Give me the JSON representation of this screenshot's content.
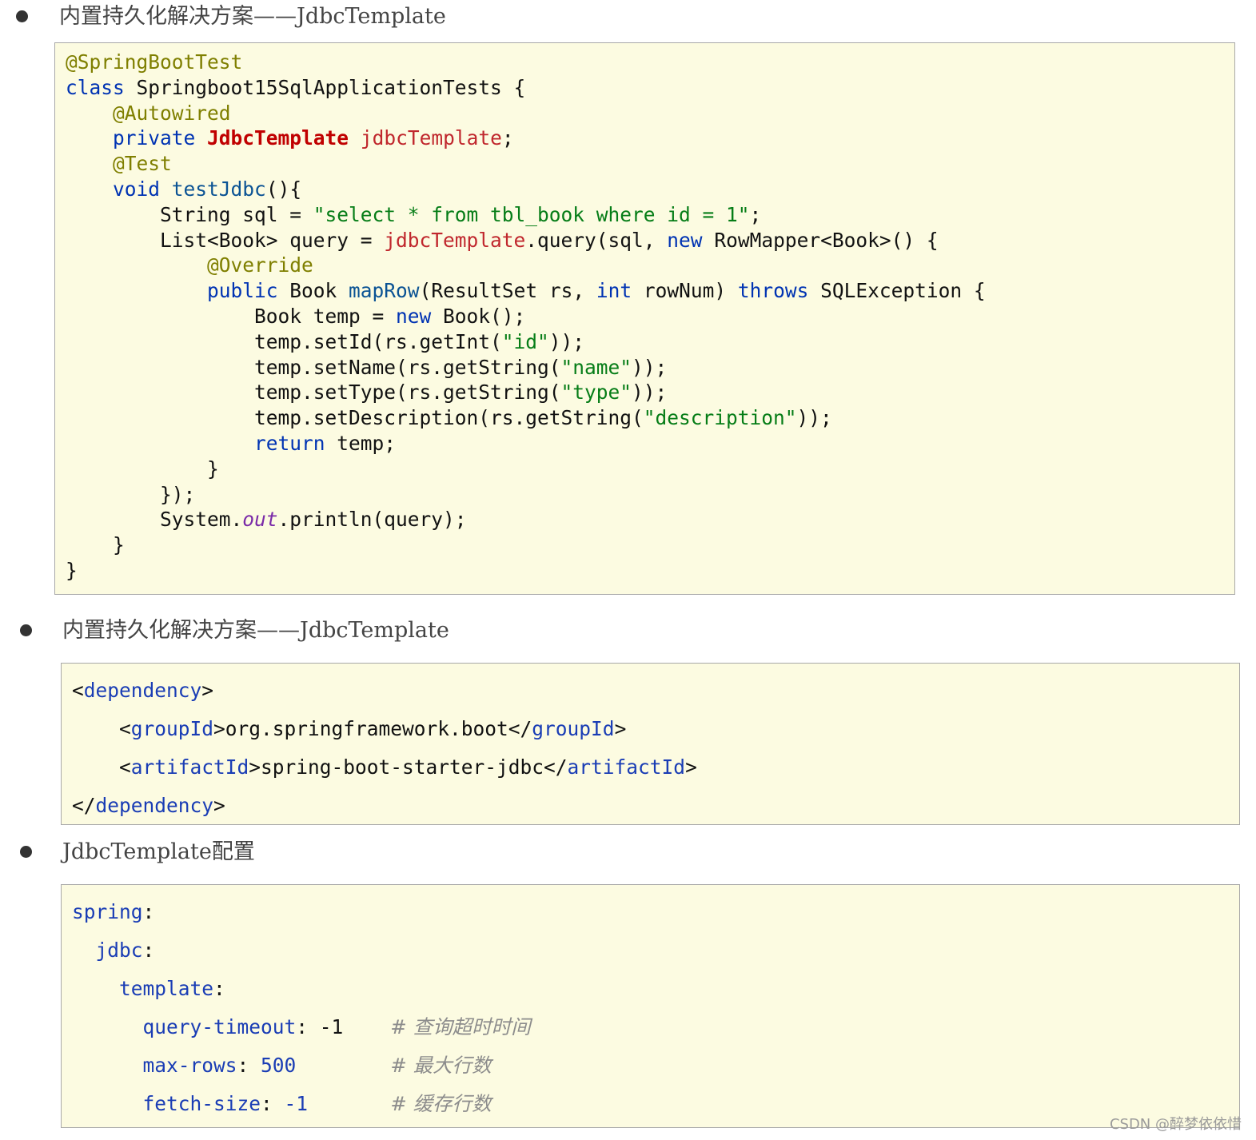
{
  "sections": [
    {
      "heading": "内置持久化解决方案——JdbcTemplate"
    },
    {
      "heading": "内置持久化解决方案——JdbcTemplate"
    },
    {
      "heading": "JdbcTemplate配置"
    }
  ],
  "code_java": [
    [
      [
        "@SpringBootTest",
        "ann"
      ]
    ],
    [
      [
        "class",
        "kw"
      ],
      [
        " Springboot15SqlApplicationTests {",
        ""
      ]
    ],
    [
      [
        "    ",
        ""
      ],
      [
        "@Autowired",
        "ann"
      ]
    ],
    [
      [
        "    ",
        ""
      ],
      [
        "private",
        "kw"
      ],
      [
        " ",
        ""
      ],
      [
        "JdbcTemplate",
        "cls"
      ],
      [
        " ",
        ""
      ],
      [
        "jdbcTemplate",
        "fld"
      ],
      [
        ";",
        ""
      ]
    ],
    [
      [
        "    ",
        ""
      ],
      [
        "@Test",
        "ann"
      ]
    ],
    [
      [
        "    ",
        ""
      ],
      [
        "void",
        "kw"
      ],
      [
        " ",
        ""
      ],
      [
        "testJdbc",
        "mth"
      ],
      [
        "(){",
        ""
      ]
    ],
    [
      [
        "        String sql = ",
        ""
      ],
      [
        "\"select * from tbl_book where id = 1\"",
        "str"
      ],
      [
        ";",
        ""
      ]
    ],
    [
      [
        "        List<Book> query = ",
        ""
      ],
      [
        "jdbcTemplate",
        "fld"
      ],
      [
        ".query(sql, ",
        ""
      ],
      [
        "new",
        "kw"
      ],
      [
        " RowMapper<Book>() {",
        ""
      ]
    ],
    [
      [
        "            ",
        ""
      ],
      [
        "@Override",
        "ann"
      ]
    ],
    [
      [
        "            ",
        ""
      ],
      [
        "public",
        "kw"
      ],
      [
        " Book ",
        ""
      ],
      [
        "mapRow",
        "mth"
      ],
      [
        "(ResultSet rs, ",
        ""
      ],
      [
        "int",
        "kw"
      ],
      [
        " rowNum) ",
        ""
      ],
      [
        "throws",
        "kw"
      ],
      [
        " SQLException {",
        ""
      ]
    ],
    [
      [
        "                Book temp = ",
        ""
      ],
      [
        "new",
        "kw"
      ],
      [
        " Book();",
        ""
      ]
    ],
    [
      [
        "                temp.setId(rs.getInt(",
        ""
      ],
      [
        "\"id\"",
        "str"
      ],
      [
        "));",
        ""
      ]
    ],
    [
      [
        "                temp.setName(rs.getString(",
        ""
      ],
      [
        "\"name\"",
        "str"
      ],
      [
        "));",
        ""
      ]
    ],
    [
      [
        "                temp.setType(rs.getString(",
        ""
      ],
      [
        "\"type\"",
        "str"
      ],
      [
        "));",
        ""
      ]
    ],
    [
      [
        "                temp.setDescription(rs.getString(",
        ""
      ],
      [
        "\"description\"",
        "str"
      ],
      [
        "));",
        ""
      ]
    ],
    [
      [
        "                ",
        ""
      ],
      [
        "return",
        "kw"
      ],
      [
        " temp;",
        ""
      ]
    ],
    [
      [
        "            }",
        ""
      ]
    ],
    [
      [
        "        });",
        ""
      ]
    ],
    [
      [
        "        System.",
        ""
      ],
      [
        "out",
        "static"
      ],
      [
        ".println(query);",
        ""
      ]
    ],
    [
      [
        "    }",
        ""
      ]
    ],
    [
      [
        "}",
        ""
      ]
    ]
  ],
  "code_xml": [
    [
      [
        "<",
        ""
      ],
      [
        "dependency",
        "tag"
      ],
      [
        ">",
        ""
      ]
    ],
    [
      [
        "    <",
        ""
      ],
      [
        "groupId",
        "tag"
      ],
      [
        ">org.springframework.boot</",
        ""
      ],
      [
        "groupId",
        "tag"
      ],
      [
        ">",
        ""
      ]
    ],
    [
      [
        "    <",
        ""
      ],
      [
        "artifactId",
        "tag"
      ],
      [
        ">spring-boot-starter-jdbc</",
        ""
      ],
      [
        "artifactId",
        "tag"
      ],
      [
        ">",
        ""
      ]
    ],
    [
      [
        "</",
        ""
      ],
      [
        "dependency",
        "tag"
      ],
      [
        ">",
        ""
      ]
    ]
  ],
  "code_yaml": [
    [
      [
        "spring",
        "ykey"
      ],
      [
        ":",
        ""
      ]
    ],
    [
      [
        "  ",
        ""
      ],
      [
        "jdbc",
        "ykey"
      ],
      [
        ":",
        ""
      ]
    ],
    [
      [
        "    ",
        ""
      ],
      [
        "template",
        "ykey"
      ],
      [
        ":",
        ""
      ]
    ],
    [
      [
        "      ",
        ""
      ],
      [
        "query-timeout",
        "ykey"
      ],
      [
        ": -1    ",
        ""
      ],
      [
        "# 查询超时时间",
        "cmt"
      ]
    ],
    [
      [
        "      ",
        ""
      ],
      [
        "max-rows",
        "ykey"
      ],
      [
        ": ",
        ""
      ],
      [
        "500",
        "ynum"
      ],
      [
        "        ",
        ""
      ],
      [
        "# 最大行数",
        "cmt"
      ]
    ],
    [
      [
        "      ",
        ""
      ],
      [
        "fetch-size",
        "ykey"
      ],
      [
        ": ",
        ""
      ],
      [
        "-1",
        "ynum"
      ],
      [
        "       ",
        ""
      ],
      [
        "# 缓存行数",
        "cmt"
      ]
    ]
  ],
  "watermark": "CSDN @醉梦依依惜"
}
